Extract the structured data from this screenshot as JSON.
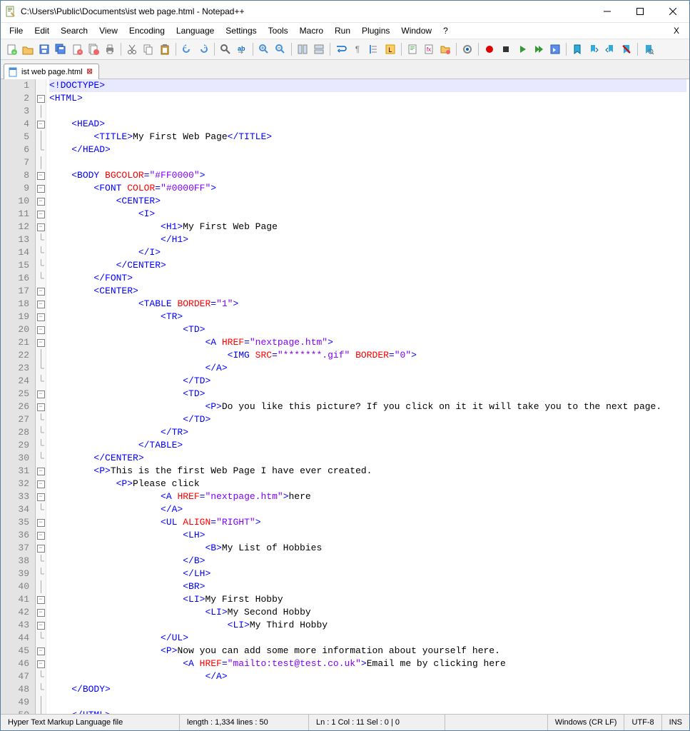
{
  "title": "C:\\Users\\Public\\Documents\\ist web page.html - Notepad++",
  "menu": [
    "File",
    "Edit",
    "Search",
    "View",
    "Encoding",
    "Language",
    "Settings",
    "Tools",
    "Macro",
    "Run",
    "Plugins",
    "Window",
    "?"
  ],
  "menu_right": "X",
  "tab": {
    "label": "ist web page.html"
  },
  "status": {
    "lang": "Hyper Text Markup Language file",
    "length": "length : 1,334    lines : 50",
    "pos": "Ln : 1    Col : 11    Sel : 0 | 0",
    "eol": "Windows (CR LF)",
    "enc": "UTF-8",
    "ins": "INS"
  },
  "toolbar_icons": [
    "new-file-icon",
    "open-file-icon",
    "save-icon",
    "save-all-icon",
    "close-icon",
    "close-all-icon",
    "print-icon",
    "sep",
    "cut-icon",
    "copy-icon",
    "paste-icon",
    "sep",
    "undo-icon",
    "redo-icon",
    "sep",
    "find-icon",
    "replace-icon",
    "sep",
    "zoom-in-icon",
    "zoom-out-icon",
    "sep",
    "sync-v-icon",
    "sync-h-icon",
    "sep",
    "wrap-icon",
    "all-chars-icon",
    "indent-guide-icon",
    "lang-icon",
    "sep",
    "doc-map-icon",
    "func-list-icon",
    "folder-icon",
    "sep",
    "monitor-icon",
    "sep",
    "record-icon",
    "stop-icon",
    "play-icon",
    "play-multi-icon",
    "save-macro-icon",
    "sep",
    "bm-toggle-icon",
    "bm-next-icon",
    "bm-prev-icon",
    "bm-clear-icon",
    "sep",
    "bm-find-icon"
  ],
  "lines": [
    {
      "n": 1,
      "fold": "",
      "cur": true,
      "seg": [
        [
          "tag",
          "<!DOCTYPE"
        ],
        [
          "tag",
          ">"
        ]
      ]
    },
    {
      "n": 2,
      "fold": "-",
      "seg": [
        [
          "tag",
          "<HTML>"
        ]
      ]
    },
    {
      "n": 3,
      "fold": "|",
      "seg": []
    },
    {
      "n": 4,
      "fold": "-",
      "ind": 1,
      "seg": [
        [
          "tag",
          "<HEAD>"
        ]
      ]
    },
    {
      "n": 5,
      "fold": "|",
      "ind": 2,
      "seg": [
        [
          "tag",
          "<TITLE>"
        ],
        [
          "txt",
          "My First Web Page"
        ],
        [
          "tag",
          "</TITLE>"
        ]
      ]
    },
    {
      "n": 6,
      "fold": "e",
      "ind": 1,
      "seg": [
        [
          "tag",
          "</HEAD>"
        ]
      ]
    },
    {
      "n": 7,
      "fold": "|",
      "seg": []
    },
    {
      "n": 8,
      "fold": "-",
      "ind": 1,
      "seg": [
        [
          "tag",
          "<BODY "
        ],
        [
          "attr",
          "BGCOLOR"
        ],
        [
          "tag",
          "="
        ],
        [
          "str",
          "\"#FF0000\""
        ],
        [
          "tag",
          ">"
        ]
      ]
    },
    {
      "n": 9,
      "fold": "-",
      "ind": 2,
      "seg": [
        [
          "tag",
          "<FONT "
        ],
        [
          "attr",
          "COLOR"
        ],
        [
          "tag",
          "="
        ],
        [
          "str",
          "\"#0000FF\""
        ],
        [
          "tag",
          ">"
        ]
      ]
    },
    {
      "n": 10,
      "fold": "-",
      "ind": 3,
      "seg": [
        [
          "tag",
          "<CENTER>"
        ]
      ]
    },
    {
      "n": 11,
      "fold": "-",
      "ind": 4,
      "seg": [
        [
          "tag",
          "<I>"
        ]
      ]
    },
    {
      "n": 12,
      "fold": "-",
      "ind": 5,
      "seg": [
        [
          "tag",
          "<H1>"
        ],
        [
          "txt",
          "My First Web Page"
        ]
      ]
    },
    {
      "n": 13,
      "fold": "e",
      "ind": 5,
      "seg": [
        [
          "tag",
          "</H1>"
        ]
      ]
    },
    {
      "n": 14,
      "fold": "e",
      "ind": 4,
      "seg": [
        [
          "tag",
          "</I>"
        ]
      ]
    },
    {
      "n": 15,
      "fold": "e",
      "ind": 3,
      "seg": [
        [
          "tag",
          "</CENTER>"
        ]
      ]
    },
    {
      "n": 16,
      "fold": "e",
      "ind": 2,
      "seg": [
        [
          "tag",
          "</FONT>"
        ]
      ]
    },
    {
      "n": 17,
      "fold": "-",
      "ind": 2,
      "seg": [
        [
          "tag",
          "<CENTER>"
        ]
      ]
    },
    {
      "n": 18,
      "fold": "-",
      "ind": 4,
      "seg": [
        [
          "tag",
          "<TABLE "
        ],
        [
          "attr",
          "BORDER"
        ],
        [
          "tag",
          "="
        ],
        [
          "str",
          "\"1\""
        ],
        [
          "tag",
          ">"
        ]
      ]
    },
    {
      "n": 19,
      "fold": "-",
      "ind": 5,
      "seg": [
        [
          "tag",
          "<TR>"
        ]
      ]
    },
    {
      "n": 20,
      "fold": "-",
      "ind": 6,
      "seg": [
        [
          "tag",
          "<TD>"
        ]
      ]
    },
    {
      "n": 21,
      "fold": "-",
      "ind": 7,
      "seg": [
        [
          "tag",
          "<A "
        ],
        [
          "attr",
          "HREF"
        ],
        [
          "tag",
          "="
        ],
        [
          "str",
          "\"nextpage.htm\""
        ],
        [
          "tag",
          ">"
        ]
      ]
    },
    {
      "n": 22,
      "fold": "|",
      "ind": 8,
      "seg": [
        [
          "tag",
          "<IMG "
        ],
        [
          "attr",
          "SRC"
        ],
        [
          "tag",
          "="
        ],
        [
          "str",
          "\"*******.gif\""
        ],
        [
          "tag",
          " "
        ],
        [
          "attr",
          "BORDER"
        ],
        [
          "tag",
          "="
        ],
        [
          "str",
          "\"0\""
        ],
        [
          "tag",
          ">"
        ]
      ]
    },
    {
      "n": 23,
      "fold": "e",
      "ind": 7,
      "seg": [
        [
          "tag",
          "</A>"
        ]
      ]
    },
    {
      "n": 24,
      "fold": "e",
      "ind": 6,
      "seg": [
        [
          "tag",
          "</TD>"
        ]
      ]
    },
    {
      "n": 25,
      "fold": "-",
      "ind": 6,
      "seg": [
        [
          "tag",
          "<TD>"
        ]
      ]
    },
    {
      "n": 26,
      "fold": "-",
      "ind": 7,
      "seg": [
        [
          "tag",
          "<P>"
        ],
        [
          "txt",
          "Do you like this picture? If you click on it it will take you to the next page."
        ]
      ]
    },
    {
      "n": 27,
      "fold": "e",
      "ind": 6,
      "seg": [
        [
          "tag",
          "</TD>"
        ]
      ]
    },
    {
      "n": 28,
      "fold": "e",
      "ind": 5,
      "seg": [
        [
          "tag",
          "</TR>"
        ]
      ]
    },
    {
      "n": 29,
      "fold": "e",
      "ind": 4,
      "seg": [
        [
          "tag",
          "</TABLE>"
        ]
      ]
    },
    {
      "n": 30,
      "fold": "e",
      "ind": 2,
      "seg": [
        [
          "tag",
          "</CENTER>"
        ]
      ]
    },
    {
      "n": 31,
      "fold": "-",
      "ind": 2,
      "seg": [
        [
          "tag",
          "<P>"
        ],
        [
          "txt",
          "This is the first Web Page I have ever created."
        ]
      ]
    },
    {
      "n": 32,
      "fold": "-",
      "ind": 3,
      "seg": [
        [
          "tag",
          "<P>"
        ],
        [
          "txt",
          "Please click"
        ]
      ]
    },
    {
      "n": 33,
      "fold": "-",
      "ind": 5,
      "seg": [
        [
          "tag",
          "<A "
        ],
        [
          "attr",
          "HREF"
        ],
        [
          "tag",
          "="
        ],
        [
          "str",
          "\"nextpage.htm\""
        ],
        [
          "tag",
          ">"
        ],
        [
          "txt",
          "here"
        ]
      ]
    },
    {
      "n": 34,
      "fold": "e",
      "ind": 5,
      "seg": [
        [
          "tag",
          "</A>"
        ]
      ]
    },
    {
      "n": 35,
      "fold": "-",
      "ind": 5,
      "seg": [
        [
          "tag",
          "<UL "
        ],
        [
          "attr",
          "ALIGN"
        ],
        [
          "tag",
          "="
        ],
        [
          "str",
          "\"RIGHT\""
        ],
        [
          "tag",
          ">"
        ]
      ]
    },
    {
      "n": 36,
      "fold": "-",
      "ind": 6,
      "seg": [
        [
          "tag",
          "<LH>"
        ]
      ]
    },
    {
      "n": 37,
      "fold": "-",
      "ind": 7,
      "seg": [
        [
          "tag",
          "<B>"
        ],
        [
          "txt",
          "My List of Hobbies"
        ]
      ]
    },
    {
      "n": 38,
      "fold": "e",
      "ind": 6,
      "seg": [
        [
          "tag",
          "</B>"
        ]
      ]
    },
    {
      "n": 39,
      "fold": "e",
      "ind": 6,
      "seg": [
        [
          "tag",
          "</LH>"
        ]
      ]
    },
    {
      "n": 40,
      "fold": "|",
      "ind": 6,
      "seg": [
        [
          "tag",
          "<BR>"
        ]
      ]
    },
    {
      "n": 41,
      "fold": "-",
      "ind": 6,
      "seg": [
        [
          "tag",
          "<LI>"
        ],
        [
          "txt",
          "My First Hobby"
        ]
      ]
    },
    {
      "n": 42,
      "fold": "-",
      "ind": 7,
      "seg": [
        [
          "tag",
          "<LI>"
        ],
        [
          "txt",
          "My Second Hobby"
        ]
      ]
    },
    {
      "n": 43,
      "fold": "-",
      "ind": 8,
      "seg": [
        [
          "tag",
          "<LI>"
        ],
        [
          "txt",
          "My Third Hobby"
        ]
      ]
    },
    {
      "n": 44,
      "fold": "e",
      "ind": 5,
      "seg": [
        [
          "tag",
          "</UL>"
        ]
      ]
    },
    {
      "n": 45,
      "fold": "-",
      "ind": 5,
      "seg": [
        [
          "tag",
          "<P>"
        ],
        [
          "txt",
          "Now you can add some more information about yourself here."
        ]
      ]
    },
    {
      "n": 46,
      "fold": "-",
      "ind": 6,
      "seg": [
        [
          "tag",
          "<A "
        ],
        [
          "attr",
          "HREF"
        ],
        [
          "tag",
          "="
        ],
        [
          "str",
          "\"mailto:test@test.co.uk\""
        ],
        [
          "tag",
          ">"
        ],
        [
          "txt",
          "Email me by clicking here"
        ]
      ]
    },
    {
      "n": 47,
      "fold": "e",
      "ind": 7,
      "seg": [
        [
          "tag",
          "</A>"
        ]
      ]
    },
    {
      "n": 48,
      "fold": "e",
      "ind": 1,
      "seg": [
        [
          "tag",
          "</BODY>"
        ]
      ]
    },
    {
      "n": 49,
      "fold": "|",
      "seg": []
    },
    {
      "n": 50,
      "fold": "e",
      "ind": 1,
      "seg": [
        [
          "tag",
          "</HTML>"
        ]
      ]
    }
  ]
}
